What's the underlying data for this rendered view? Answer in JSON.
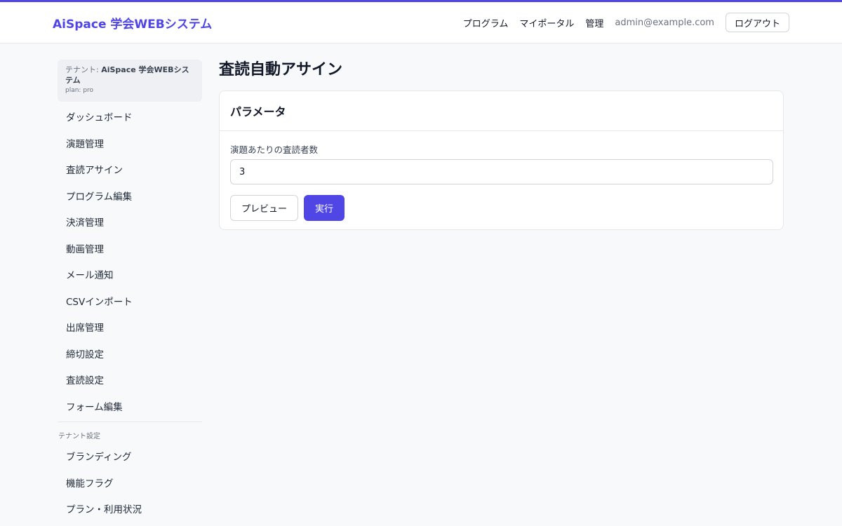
{
  "header": {
    "brand": "AiSpace 学会WEBシステム",
    "nav": [
      "プログラム",
      "マイポータル",
      "管理"
    ],
    "user_email": "admin@example.com",
    "logout_label": "ログアウト"
  },
  "sidebar": {
    "tenant_prefix": "テナント:",
    "tenant_name": "AiSpace 学会WEBシステム",
    "plan": "plan: pro",
    "items": [
      {
        "label": "ダッシュボード"
      },
      {
        "label": "演題管理"
      },
      {
        "label": "査読アサイン"
      },
      {
        "label": "プログラム編集"
      },
      {
        "label": "決済管理"
      },
      {
        "label": "動画管理"
      },
      {
        "label": "メール通知"
      },
      {
        "label": "CSVインポート"
      },
      {
        "label": "出席管理"
      },
      {
        "label": "締切設定"
      },
      {
        "label": "査読設定"
      },
      {
        "label": "フォーム編集"
      }
    ],
    "section_label": "テナント設定",
    "section_items": [
      {
        "label": "ブランディング"
      },
      {
        "label": "機能フラグ"
      },
      {
        "label": "プラン・利用状況"
      }
    ]
  },
  "main": {
    "title": "査読自動アサイン",
    "card_title": "パラメータ",
    "field_label": "演題あたりの査読者数",
    "field_value": "3",
    "preview_label": "プレビュー",
    "run_label": "実行"
  },
  "colors": {
    "accent": "#4f46e5",
    "background": "#f8f9fb"
  }
}
